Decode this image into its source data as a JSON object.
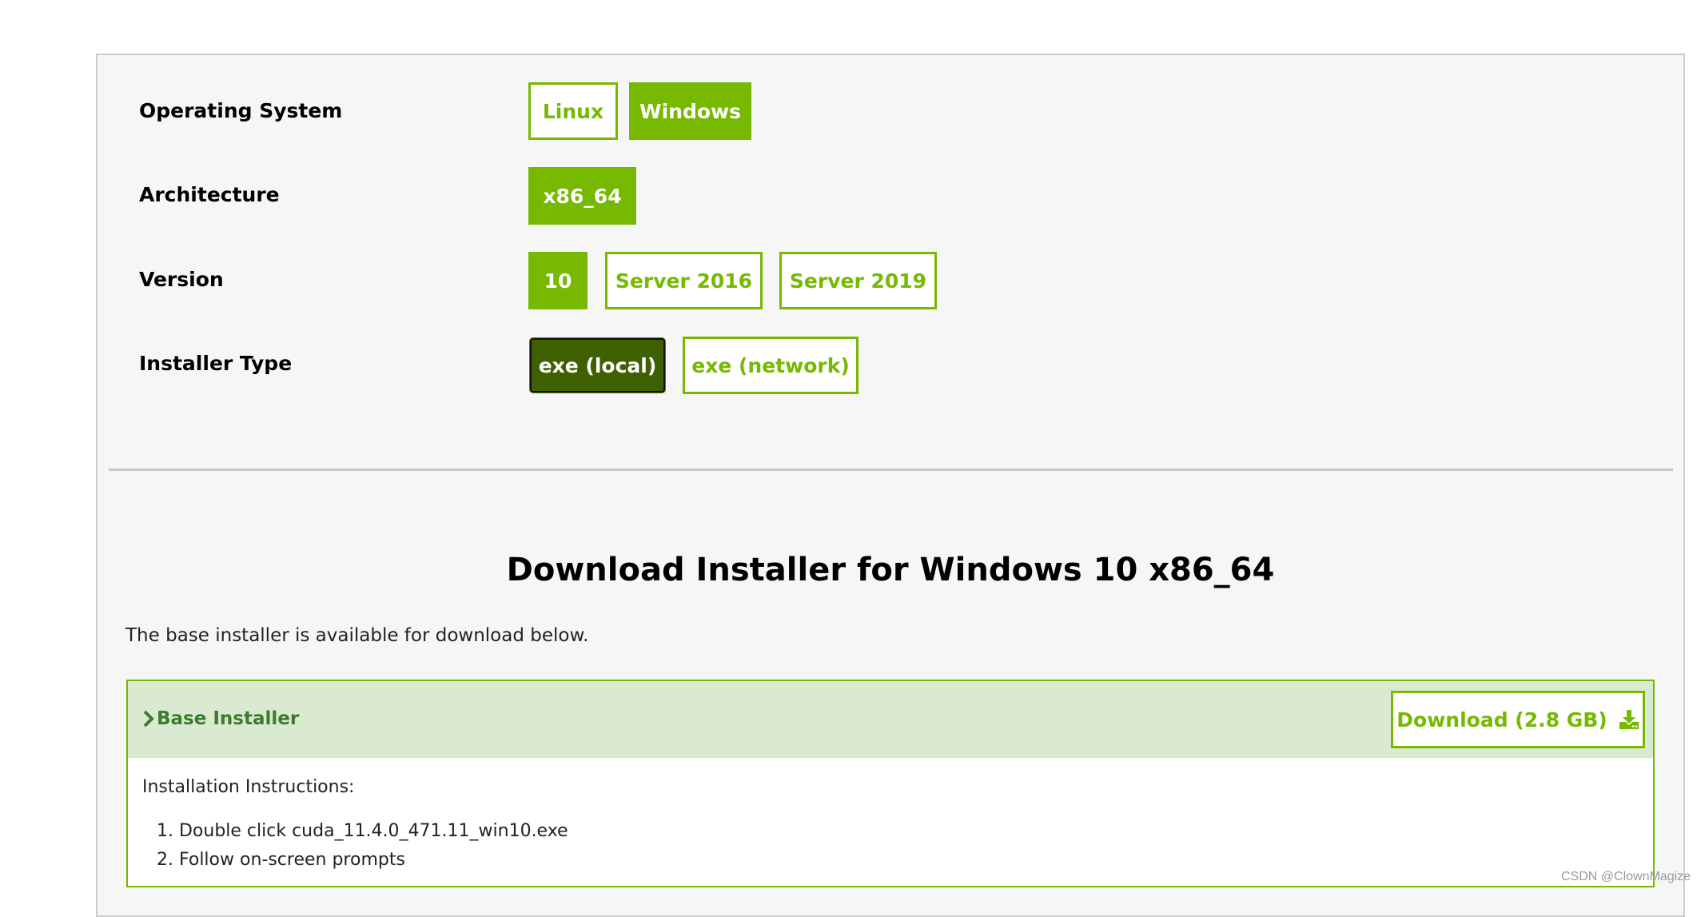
{
  "colors": {
    "accent": "#76b900",
    "accent_dark": "#3f6000",
    "panel_bg": "#f6f6f6",
    "header_band": "#d9ead0",
    "header_text": "#3d7a2f"
  },
  "selectors": [
    {
      "label": "Operating System",
      "options": [
        {
          "label": "Linux",
          "selected": false
        },
        {
          "label": "Windows",
          "selected": true
        }
      ]
    },
    {
      "label": "Architecture",
      "options": [
        {
          "label": "x86_64",
          "selected": true
        }
      ]
    },
    {
      "label": "Version",
      "options": [
        {
          "label": "10",
          "selected": true
        },
        {
          "label": "Server 2016",
          "selected": false
        },
        {
          "label": "Server 2019",
          "selected": false
        }
      ]
    },
    {
      "label": "Installer Type",
      "options": [
        {
          "label": "exe (local)",
          "selected": true
        },
        {
          "label": "exe (network)",
          "selected": false
        }
      ]
    }
  ],
  "download": {
    "title": "Download Installer for Windows 10 x86_64",
    "subtext": "The base installer is available for download below.",
    "base_installer": {
      "label": "Base Installer",
      "chevron_icon": "chevron-right-icon",
      "button_label": "Download (2.8 GB)",
      "button_icon": "download-icon",
      "instructions_heading": "Installation Instructions:",
      "steps": [
        "1. Double click cuda_11.4.0_471.11_win10.exe",
        "2. Follow on-screen prompts"
      ]
    }
  },
  "watermark": "CSDN @ClownMagize"
}
